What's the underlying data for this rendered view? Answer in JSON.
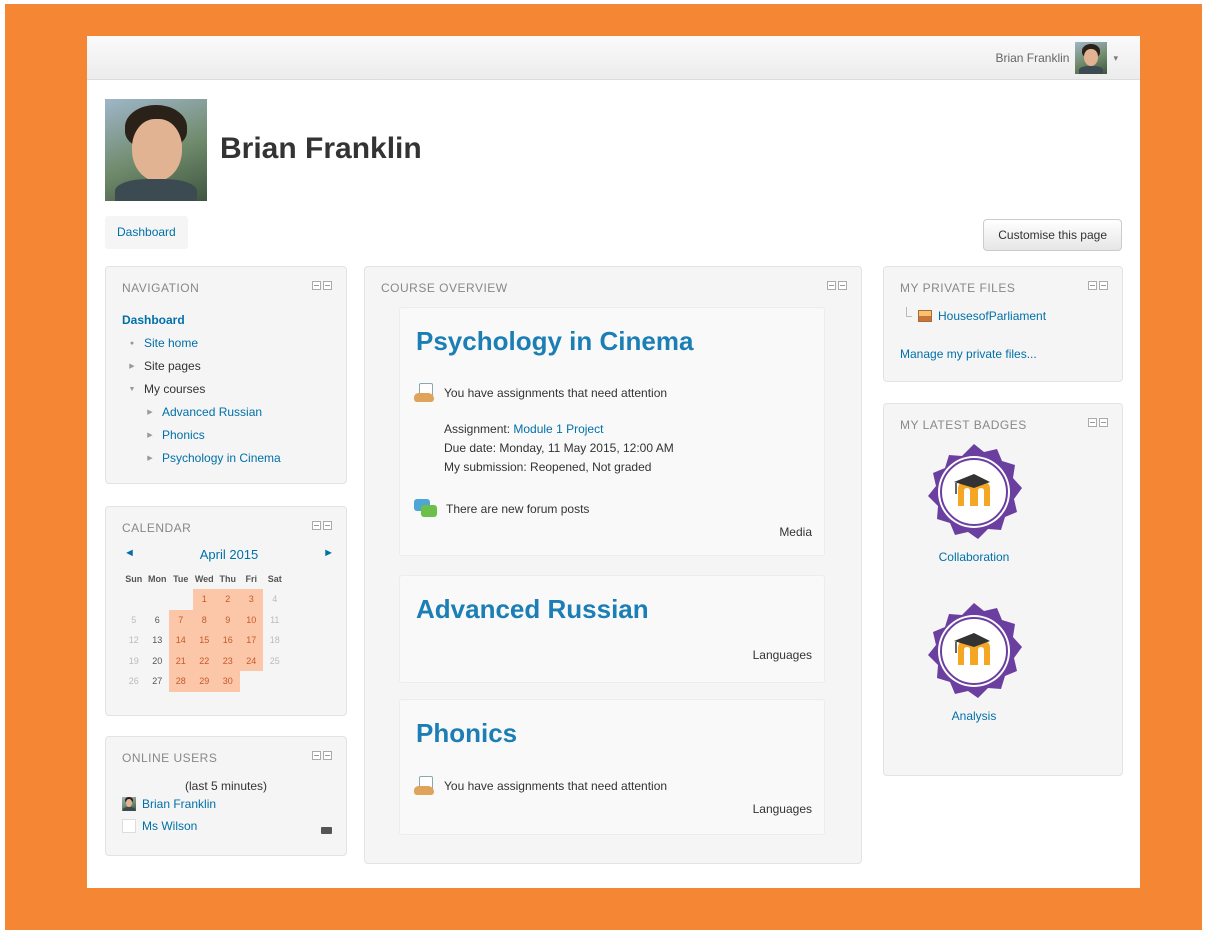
{
  "navbar": {
    "user_name": "Brian Franklin",
    "menu_caret": "▾"
  },
  "profile": {
    "name": "Brian Franklin"
  },
  "breadcrumb": {
    "label": "Dashboard"
  },
  "buttons": {
    "customise": "Customise this page"
  },
  "colors": {
    "frame": "#f58634",
    "link": "#0070a8",
    "course_title": "#1b7eb5",
    "calendar_highlight": "#fcc6a8",
    "badge_purple": "#6b3fa0",
    "badge_orange": "#f5a623"
  },
  "navigation": {
    "title": "NAVIGATION",
    "dashboard": "Dashboard",
    "site_home": "Site home",
    "site_pages": "Site pages",
    "my_courses": "My courses",
    "courses": [
      "Advanced Russian",
      "Phonics",
      "Psychology in Cinema"
    ]
  },
  "calendar": {
    "title": "CALENDAR",
    "month": "April 2015",
    "prev": "◄",
    "next": "►",
    "weekdays": [
      "Sun",
      "Mon",
      "Tue",
      "Wed",
      "Thu",
      "Fri",
      "Sat"
    ],
    "weeks": [
      [
        "",
        "",
        "",
        "1",
        "2",
        "3",
        "4"
      ],
      [
        "5",
        "6",
        "7",
        "8",
        "9",
        "10",
        "11"
      ],
      [
        "12",
        "13",
        "14",
        "15",
        "16",
        "17",
        "18"
      ],
      [
        "19",
        "20",
        "21",
        "22",
        "23",
        "24",
        "25"
      ],
      [
        "26",
        "27",
        "28",
        "29",
        "30",
        "",
        ""
      ]
    ],
    "highlighted_days": [
      "1",
      "2",
      "3",
      "7",
      "8",
      "9",
      "10",
      "14",
      "15",
      "16",
      "17",
      "21",
      "22",
      "23",
      "24",
      "28",
      "29",
      "30"
    ]
  },
  "online_users": {
    "title": "ONLINE USERS",
    "subtitle": "(last 5 minutes)",
    "users": [
      "Brian Franklin",
      "Ms Wilson"
    ]
  },
  "course_overview": {
    "title": "COURSE OVERVIEW",
    "courses": [
      {
        "name": "Psychology in Cinema",
        "assignments_notice": "You have assignments that need attention",
        "assignment_label": "Assignment:",
        "assignment_name": "Module 1 Project",
        "due": "Due date: Monday, 11 May 2015, 12:00 AM",
        "submission": "My submission: Reopened, Not graded",
        "forum_notice": "There are new forum posts",
        "category": "Media"
      },
      {
        "name": "Advanced Russian",
        "category": "Languages"
      },
      {
        "name": "Phonics",
        "assignments_notice": "You have assignments that need attention",
        "category": "Languages"
      }
    ]
  },
  "private_files": {
    "title": "MY PRIVATE FILES",
    "file": "HousesofParliament",
    "manage": "Manage my private files..."
  },
  "badges": {
    "title": "MY LATEST BADGES",
    "items": [
      {
        "name": "Collaboration",
        "ribbon": "COLLABORATION"
      },
      {
        "name": "Analysis",
        "ribbon": "ANALYSIS"
      }
    ]
  }
}
